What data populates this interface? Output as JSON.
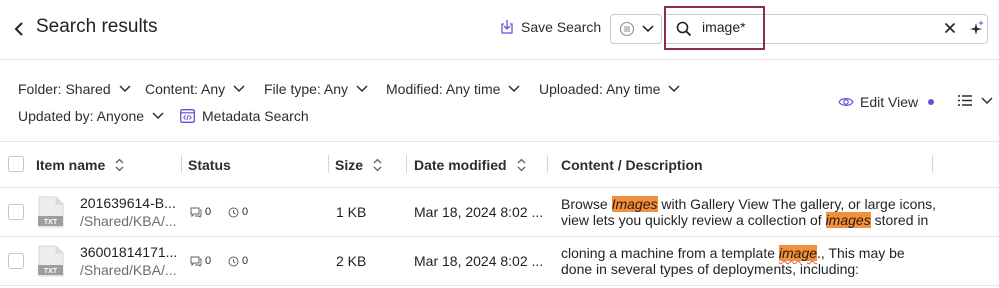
{
  "header": {
    "title": "Search results",
    "save_search_label": "Save Search",
    "search_value": "image*"
  },
  "filters": {
    "folder": "Folder: Shared",
    "content": "Content: Any",
    "file_type": "File type: Any",
    "modified": "Modified: Any time",
    "uploaded": "Uploaded: Any time",
    "updated_by": "Updated by: Anyone",
    "metadata_search": "Metadata Search",
    "edit_view": "Edit View"
  },
  "table": {
    "columns": {
      "item_name": "Item name",
      "status": "Status",
      "size": "Size",
      "date_modified": "Date modified",
      "content": "Content / Description"
    },
    "rows": [
      {
        "name": "201639614-B...",
        "path": "/Shared/KBA/...",
        "file_type": "TXT",
        "comments": "0",
        "versions": "0",
        "size": "1 KB",
        "date": "Mar 18, 2024 8:02 ...",
        "desc_line1": [
          "Browse ",
          "Images",
          " with Gallery View The gallery, or large icons,"
        ],
        "desc_line2": [
          "view lets you quickly review a collection of ",
          "images",
          " stored in"
        ]
      },
      {
        "name": "36001814171...",
        "path": "/Shared/KBA/...",
        "file_type": "TXT",
        "comments": "0",
        "versions": "0",
        "size": "2 KB",
        "date": "Mar 18, 2024 8:02 ...",
        "desc_line1": [
          "cloning a machine from a template ",
          "image",
          "., This may be"
        ],
        "desc_line2": [
          "done in several types of deployments, including:"
        ]
      }
    ]
  },
  "colors": {
    "accent": "#6b4fd0",
    "focus_border": "#8a2a57",
    "highlight": "#f0913f"
  }
}
